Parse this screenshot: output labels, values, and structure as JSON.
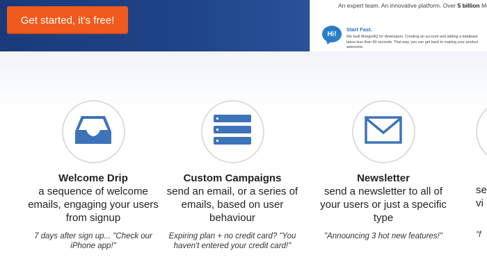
{
  "hero": {
    "cta_label": "Get started, it's free!",
    "tagline_prefix": "An expert team. An innovative platform. Over ",
    "tagline_bold": "5 billion",
    "tagline_suffix": " Mon",
    "badge_text": "Hi!",
    "start_title": "Start Fast.",
    "start_body": "We built MongoHQ for developers. Creating an account and adding a database takes less than 60 seconds. That way, you can get back to making your product awesome."
  },
  "features": [
    {
      "icon": "inbox-tray-icon",
      "title": "Welcome Drip",
      "desc": "a sequence of welcome emails, engaging your users from signup",
      "quote": "7 days after sign up... \"Check our iPhone app!\""
    },
    {
      "icon": "list-bars-icon",
      "title": "Custom Campaigns",
      "desc": "send an email, or a series of emails, based on user behaviour",
      "quote": "Expiring plan + no credit card? \"You haven't entered your credit card!\""
    },
    {
      "icon": "envelope-icon",
      "title": "Newsletter",
      "desc": "send a newsletter to all of your users or just a specific type",
      "quote": "\"Announcing 3 hot new features!\""
    },
    {
      "title": "",
      "desc": "se vi",
      "quote": "\"f"
    }
  ],
  "colors": {
    "cta": "#f05a1c",
    "hero_blue": "#1f4488",
    "icon_blue": "#3d73b9"
  }
}
